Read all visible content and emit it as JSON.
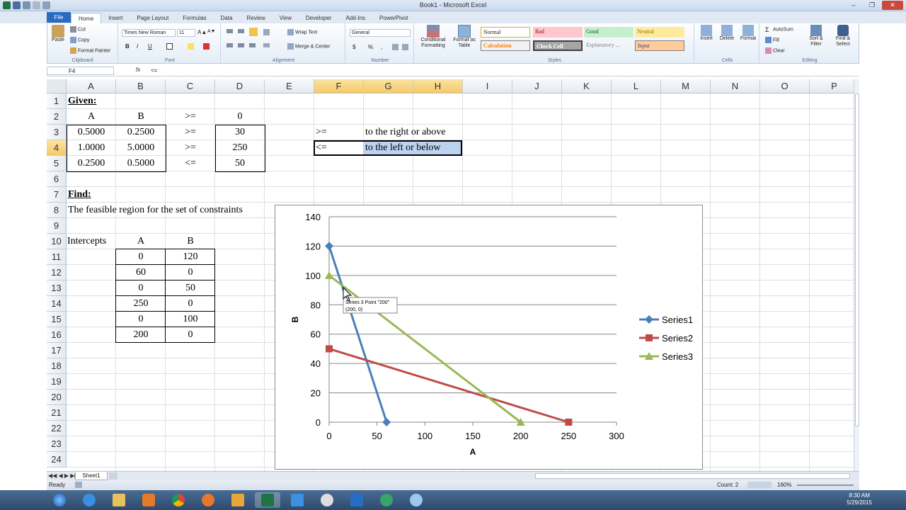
{
  "window": {
    "title": "Book1 - Microsoft Excel"
  },
  "ribbon": {
    "tabs": [
      "File",
      "Home",
      "Insert",
      "Page Layout",
      "Formulas",
      "Data",
      "Review",
      "View",
      "Developer",
      "Add-Ins",
      "PowerPivot"
    ],
    "clipboard": {
      "paste": "Paste",
      "cut": "Cut",
      "copy": "Copy",
      "format_painter": "Format Painter",
      "label": "Clipboard"
    },
    "font": {
      "name": "Times New Roman",
      "size": "11",
      "bold": "B",
      "italic": "I",
      "underline": "U",
      "label": "Font"
    },
    "alignment": {
      "wrap": "Wrap Text",
      "merge": "Merge & Center",
      "label": "Alignment"
    },
    "number": {
      "format": "General",
      "currency": "$",
      "percent": "%",
      "comma": ",",
      "label": "Number"
    },
    "styles": {
      "conditional": "Conditional Formatting",
      "format_table": "Format as Table",
      "cells": [
        "Normal",
        "Bad",
        "Good",
        "Neutral",
        "Calculation",
        "Check Cell",
        "Explanatory ...",
        "Input"
      ],
      "label": "Styles"
    },
    "cells": {
      "insert": "Insert",
      "delete": "Delete",
      "format": "Format",
      "label": "Cells"
    },
    "editing": {
      "autosum": "AutoSum",
      "fill": "Fill",
      "clear": "Clear",
      "sort": "Sort & Filter",
      "find": "Find & Select",
      "label": "Editing"
    }
  },
  "formula_bar": {
    "name_box": "F4",
    "fx": "fx",
    "formula": "<="
  },
  "grid": {
    "columns": [
      "A",
      "B",
      "C",
      "D",
      "E",
      "F",
      "G",
      "H",
      "I",
      "J",
      "K",
      "L",
      "M",
      "N",
      "O",
      "P"
    ],
    "rows": [
      "1",
      "2",
      "3",
      "4",
      "5",
      "6",
      "7",
      "8",
      "9",
      "10",
      "11",
      "12",
      "13",
      "14",
      "15",
      "16",
      "17",
      "18",
      "19",
      "20",
      "21",
      "22",
      "23",
      "24"
    ],
    "given": "Given:",
    "header_a": "A",
    "header_b": "B",
    "header_op": ">=",
    "header_rhs": "0",
    "constraints": [
      {
        "a": "0.5000",
        "b": "0.2500",
        "op": ">=",
        "rhs": "30"
      },
      {
        "a": "1.0000",
        "b": "5.0000",
        "op": ">=",
        "rhs": "250"
      },
      {
        "a": "0.2500",
        "b": "0.5000",
        "op": "<=",
        "rhs": "50"
      }
    ],
    "legend_ge": ">=",
    "legend_ge_text": "to the right or above",
    "legend_le": "<=",
    "legend_le_text": "to the left or below",
    "find": "Find:",
    "find_text": "The feasible region for the set of constraints",
    "intercepts_label": "Intercepts",
    "int_header_a": "A",
    "int_header_b": "B",
    "intercepts": [
      {
        "a": "0",
        "b": "120"
      },
      {
        "a": "60",
        "b": "0"
      },
      {
        "a": "0",
        "b": "50"
      },
      {
        "a": "250",
        "b": "0"
      },
      {
        "a": "0",
        "b": "100"
      },
      {
        "a": "200",
        "b": "0"
      }
    ]
  },
  "chart_data": {
    "type": "scatter",
    "xlabel": "A",
    "ylabel": "B",
    "xlim": [
      0,
      300
    ],
    "ylim": [
      0,
      140
    ],
    "xticks": [
      "0",
      "50",
      "100",
      "150",
      "200",
      "250",
      "300"
    ],
    "yticks": [
      "0",
      "20",
      "40",
      "60",
      "80",
      "100",
      "120",
      "140"
    ],
    "grid": "horizontal",
    "legend_position": "right",
    "series": [
      {
        "name": "Series1",
        "x": [
          0,
          60
        ],
        "y": [
          120,
          0
        ],
        "color": "#4a7ebb",
        "marker": "diamond"
      },
      {
        "name": "Series2",
        "x": [
          0,
          250
        ],
        "y": [
          50,
          0
        ],
        "color": "#be4b48",
        "marker": "square"
      },
      {
        "name": "Series3",
        "x": [
          0,
          200
        ],
        "y": [
          100,
          0
        ],
        "color": "#98b954",
        "marker": "triangle"
      }
    ],
    "tooltip": {
      "line1": "Series 3 Point \"200\"",
      "line2": "(200, 0)"
    }
  },
  "sheets": {
    "tabs": [
      "Sheet1"
    ]
  },
  "status": {
    "ready": "Ready",
    "count": "Count: 2",
    "zoom": "160%"
  },
  "taskbar": {
    "time": "8:30 AM",
    "date": "5/29/2015"
  }
}
